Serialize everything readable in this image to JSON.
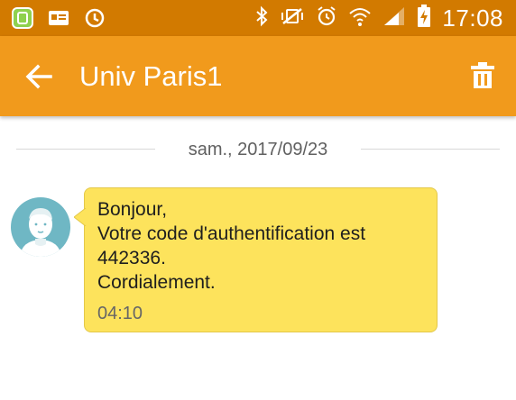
{
  "status_bar": {
    "time": "17:08",
    "icons": [
      "app-notification-icon",
      "id-card-icon",
      "sync-icon",
      "bluetooth-icon",
      "mute-vibrate-icon",
      "alarm-icon",
      "wifi-icon",
      "signal-icon",
      "battery-charging-icon"
    ],
    "background": "#d27a00"
  },
  "header": {
    "title": "Univ Paris1",
    "back_icon": "arrow-back-icon",
    "delete_icon": "trash-icon",
    "background": "#f19a1c"
  },
  "conversation": {
    "date_separator": "sam., 2017/09/23",
    "messages": [
      {
        "sender_avatar": "avatar-icon",
        "lines": [
          "Bonjour,",
          "Votre code d'authentification est",
          "442336.",
          "Cordialement."
        ],
        "time": "04:10",
        "bubble_color": "#fde35c"
      }
    ]
  }
}
